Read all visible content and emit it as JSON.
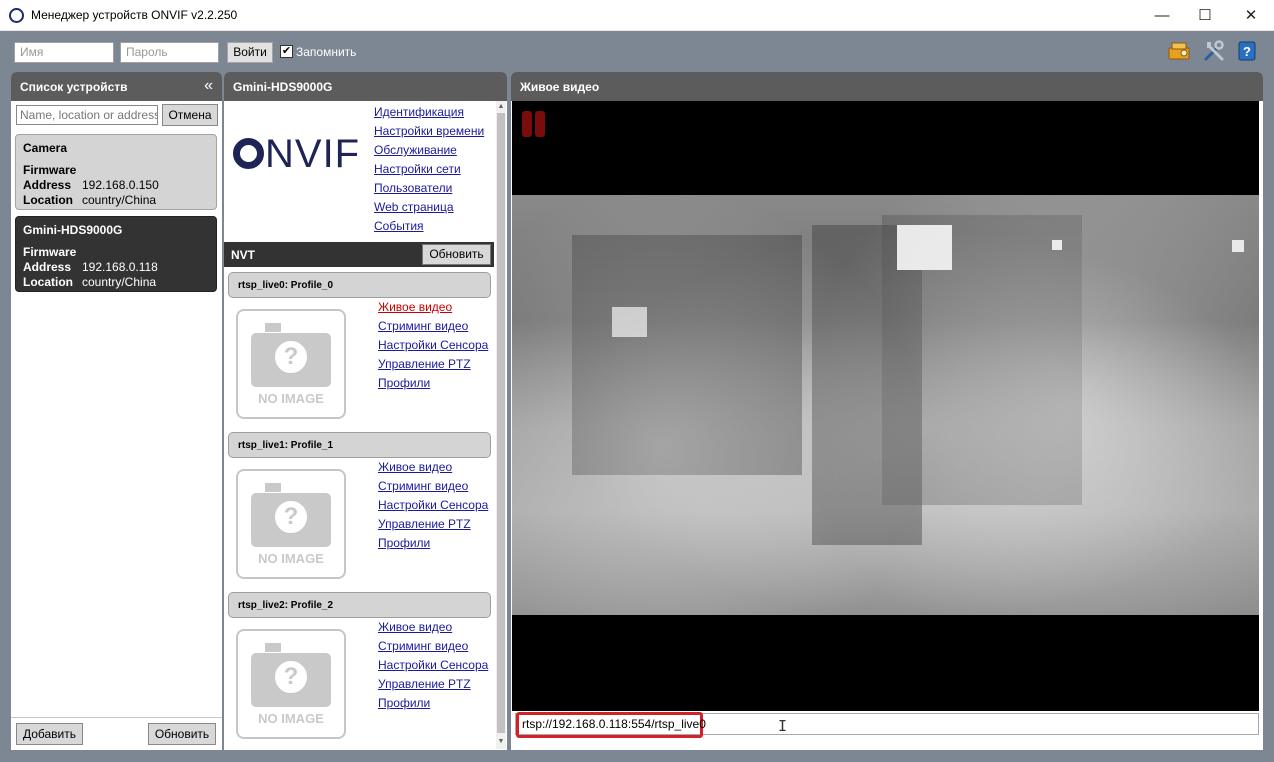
{
  "window": {
    "title": "Менеджер устройств ONVIF v2.2.250",
    "minimize": "—",
    "maximize": "☐",
    "close": "✕"
  },
  "login": {
    "username_placeholder": "Имя",
    "password_placeholder": "Пароль",
    "login_button": "Войти",
    "remember_label": "Запомнить",
    "remember_checked": "✔"
  },
  "toolbar_icons": [
    "settings-wizard-icon",
    "tools-icon",
    "help-icon"
  ],
  "device_list": {
    "title": "Список устройств",
    "collapse_icon": "«",
    "search_placeholder": "Name, location or address",
    "cancel_button": "Отмена",
    "devices": [
      {
        "name": "Camera",
        "firmware_label": "Firmware",
        "address_label": "Address",
        "address": "192.168.0.150",
        "location_label": "Location",
        "location": "country/China",
        "selected": false
      },
      {
        "name": "Gmini-HDS9000G",
        "firmware_label": "Firmware",
        "address_label": "Address",
        "address": "192.168.0.118",
        "location_label": "Location",
        "location": "country/China",
        "selected": true
      }
    ],
    "add_button": "Добавить",
    "refresh_button": "Обновить"
  },
  "device_panel": {
    "title": "Gmini-HDS9000G",
    "logo_text": "NVIF",
    "menu_links": [
      "Идентификация",
      "Настройки времени",
      "Обслуживание",
      "Настройки сети",
      "Пользователи",
      "Web страница",
      "События"
    ],
    "nvt_label": "NVT",
    "nvt_refresh": "Обновить",
    "no_image_text": "NO IMAGE",
    "no_image_glyph": "?",
    "profiles": [
      {
        "header": "rtsp_live0: Profile_0",
        "links": [
          "Живое видео",
          "Стриминг видео",
          "Настройки Сенсора",
          "Управление PTZ",
          "Профили"
        ],
        "active_link": 0
      },
      {
        "header": "rtsp_live1: Profile_1",
        "links": [
          "Живое видео",
          "Стриминг видео",
          "Настройки Сенсора",
          "Управление PTZ",
          "Профили"
        ],
        "active_link": -1
      },
      {
        "header": "rtsp_live2: Profile_2",
        "links": [
          "Живое видео",
          "Стриминг видео",
          "Настройки Сенсора",
          "Управление PTZ",
          "Профили"
        ],
        "active_link": -1
      }
    ],
    "scroll_up": "▲",
    "scroll_down": "▼"
  },
  "live_video": {
    "title": "Живое видео",
    "stream_url": "rtsp://192.168.0.118:554/rtsp_live0",
    "text_cursor": "I",
    "paused": true
  },
  "colors": {
    "app_background": "#7d8794",
    "panel_header": "#5c5c5c",
    "link": "#1a1a9c",
    "active_link": "#c80000",
    "highlight_border": "#d42027"
  }
}
